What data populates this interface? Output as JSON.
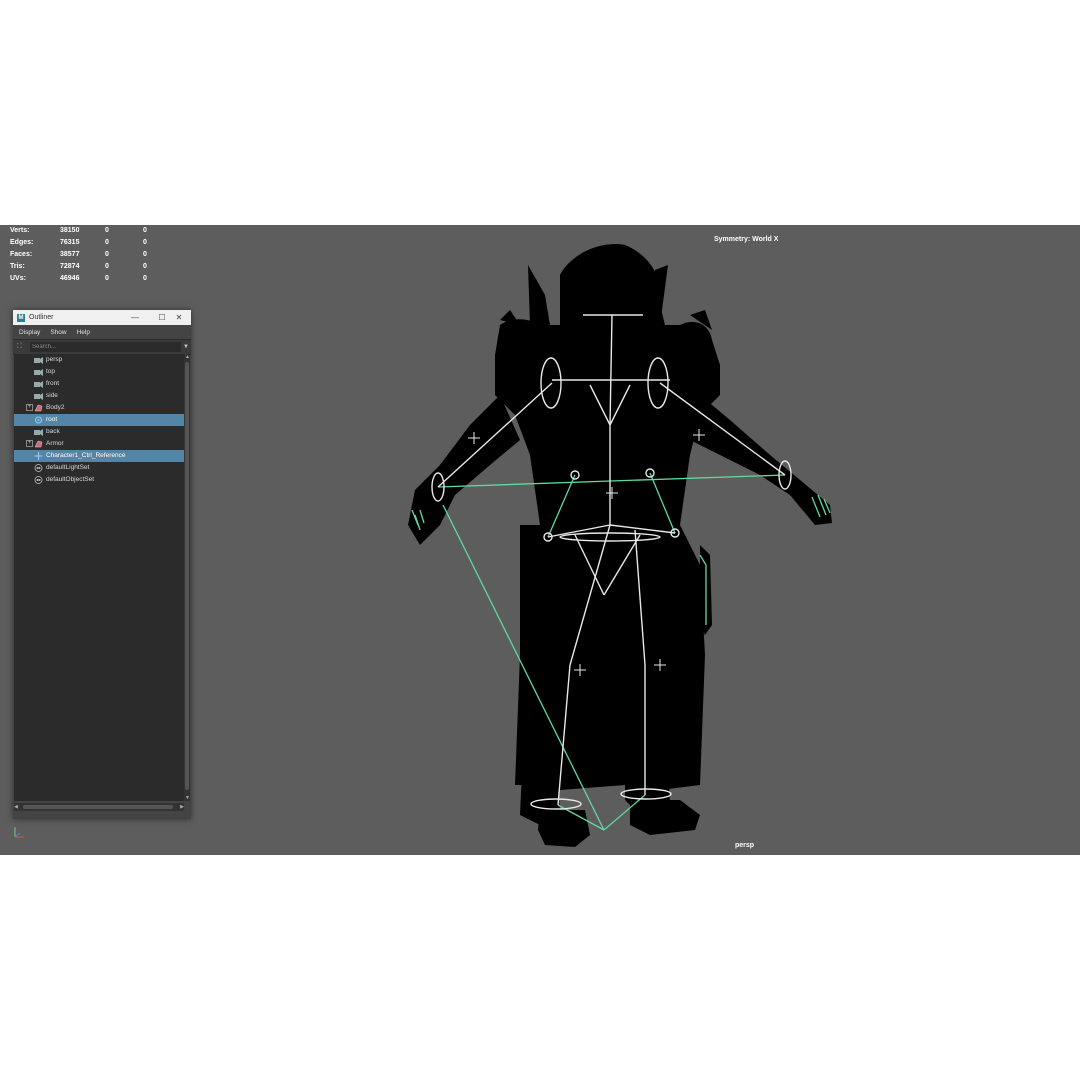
{
  "hud": {
    "rows": [
      {
        "label": "Verts:",
        "v1": "38150",
        "v2": "0",
        "v3": "0"
      },
      {
        "label": "Edges:",
        "v1": "76315",
        "v2": "0",
        "v3": "0"
      },
      {
        "label": "Faces:",
        "v1": "38577",
        "v2": "0",
        "v3": "0"
      },
      {
        "label": "Tris:",
        "v1": "72874",
        "v2": "0",
        "v3": "0"
      },
      {
        "label": "UVs:",
        "v1": "46946",
        "v2": "0",
        "v3": "0"
      }
    ]
  },
  "viewport": {
    "symmetry": "Symmetry: World X",
    "camera": "persp",
    "background": "#5d5d5d",
    "joint_color": "#e8e8e8",
    "control_color": "#5fd9a0"
  },
  "outliner": {
    "title": "Outliner",
    "menu": [
      "Display",
      "Show",
      "Help"
    ],
    "search_placeholder": "Search...",
    "items": [
      {
        "label": "persp",
        "icon": "camera-icon",
        "expand": false,
        "selected": false
      },
      {
        "label": "top",
        "icon": "camera-icon",
        "expand": false,
        "selected": false
      },
      {
        "label": "front",
        "icon": "camera-icon",
        "expand": false,
        "selected": false
      },
      {
        "label": "side",
        "icon": "camera-icon",
        "expand": false,
        "selected": false
      },
      {
        "label": "Body2",
        "icon": "mesh-icon",
        "expand": true,
        "selected": false
      },
      {
        "label": "root",
        "icon": "joint-icon",
        "expand": false,
        "selected": true
      },
      {
        "label": "back",
        "icon": "camera-icon",
        "expand": false,
        "selected": false
      },
      {
        "label": "Armor",
        "icon": "mesh-icon",
        "expand": true,
        "selected": false
      },
      {
        "label": "Character1_Ctrl_Reference",
        "icon": "locator-icon",
        "expand": false,
        "selected": true
      },
      {
        "label": "defaultLightSet",
        "icon": "set-icon",
        "expand": false,
        "selected": false
      },
      {
        "label": "defaultObjectSet",
        "icon": "set-icon",
        "expand": false,
        "selected": false
      }
    ]
  }
}
